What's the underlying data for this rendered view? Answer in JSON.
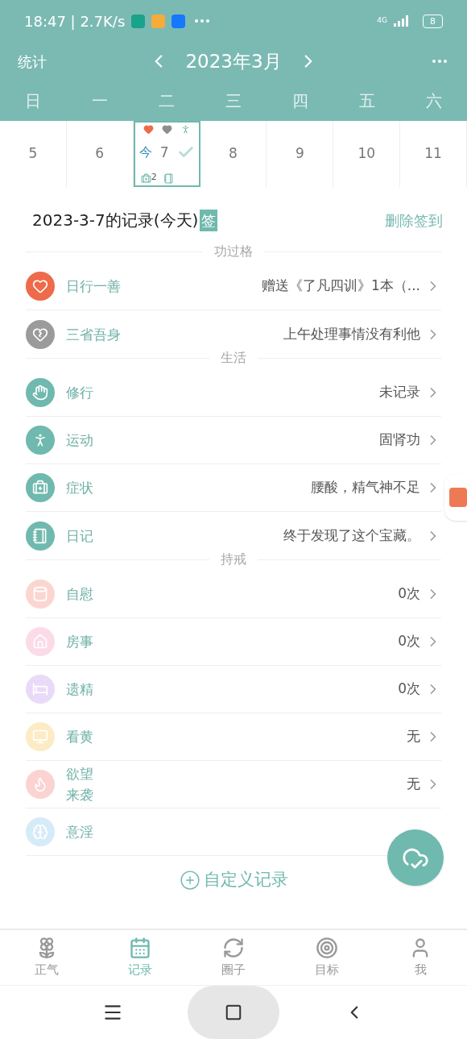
{
  "status_bar": {
    "time": "18:47 | 2.7K/s",
    "network": "4G",
    "battery": "8"
  },
  "header": {
    "left": "统计",
    "month": "2023年3月"
  },
  "weekdays": [
    "日",
    "一",
    "二",
    "三",
    "四",
    "五",
    "六"
  ],
  "days": [
    {
      "label": "5",
      "selected": false
    },
    {
      "label": "6",
      "selected": false
    },
    {
      "label": "7",
      "selected": true,
      "today_label": "今",
      "checked": true,
      "count": "2",
      "marks": [
        {
          "kind": "heart"
        },
        {
          "kind": "heartbreak"
        },
        {
          "kind": "runner"
        },
        {
          "kind": "medkit"
        },
        {
          "kind": "book"
        }
      ]
    },
    {
      "label": "8",
      "selected": false
    },
    {
      "label": "9",
      "selected": false
    },
    {
      "label": "10",
      "selected": false
    },
    {
      "label": "11",
      "selected": false
    }
  ],
  "record": {
    "title": "2023-3-7的记录(今天)",
    "sign_badge": "签",
    "delete_action": "删除签到"
  },
  "sections": [
    {
      "title": "功过格",
      "items": [
        {
          "kind": "heart",
          "color": "#ee6a4a",
          "label": "日行一善",
          "value": "赠送《了凡四训》1本（..."
        },
        {
          "kind": "heartbreak",
          "color": "#9b9b9b",
          "label": "三省吾身",
          "value": "上午处理事情没有利他"
        }
      ]
    },
    {
      "title": "生活",
      "items": [
        {
          "kind": "hands",
          "color": "#6fb9ae",
          "label": "修行",
          "value": "未记录"
        },
        {
          "kind": "runner",
          "color": "#6fb9ae",
          "label": "运动",
          "value": "固肾功"
        },
        {
          "kind": "medkit",
          "color": "#6fb9ae",
          "label": "症状",
          "value": "腰酸，精气神不足"
        },
        {
          "kind": "book",
          "color": "#6fb9ae",
          "label": "日记",
          "value": "终于发现了这个宝藏。"
        }
      ]
    },
    {
      "title": "持戒",
      "items": [
        {
          "kind": "roll",
          "color": "#fbd6d1",
          "label": "自慰",
          "value": "0次"
        },
        {
          "kind": "house",
          "color": "#fbdbe7",
          "label": "房事",
          "value": "0次"
        },
        {
          "kind": "bed",
          "color": "#e9dbf8",
          "label": "遗精",
          "value": "0次"
        },
        {
          "kind": "monitor",
          "color": "#fcecc6",
          "label": "看黄",
          "value": "无"
        },
        {
          "kind": "flame",
          "color": "#fbd3d1",
          "label_lines": [
            "欲望",
            "来袭"
          ],
          "value": "无"
        },
        {
          "kind": "brain",
          "color": "#d6ebf8",
          "label": "意淫"
        }
      ]
    }
  ],
  "add_custom": "自定义记录",
  "tabs": [
    {
      "kind": "lotus",
      "label": "正气",
      "selected": false
    },
    {
      "kind": "calendar",
      "label": "记录",
      "selected": true
    },
    {
      "kind": "circle",
      "label": "圈子",
      "selected": false
    },
    {
      "kind": "target",
      "label": "目标",
      "selected": false
    },
    {
      "kind": "user",
      "label": "我",
      "selected": false
    }
  ]
}
